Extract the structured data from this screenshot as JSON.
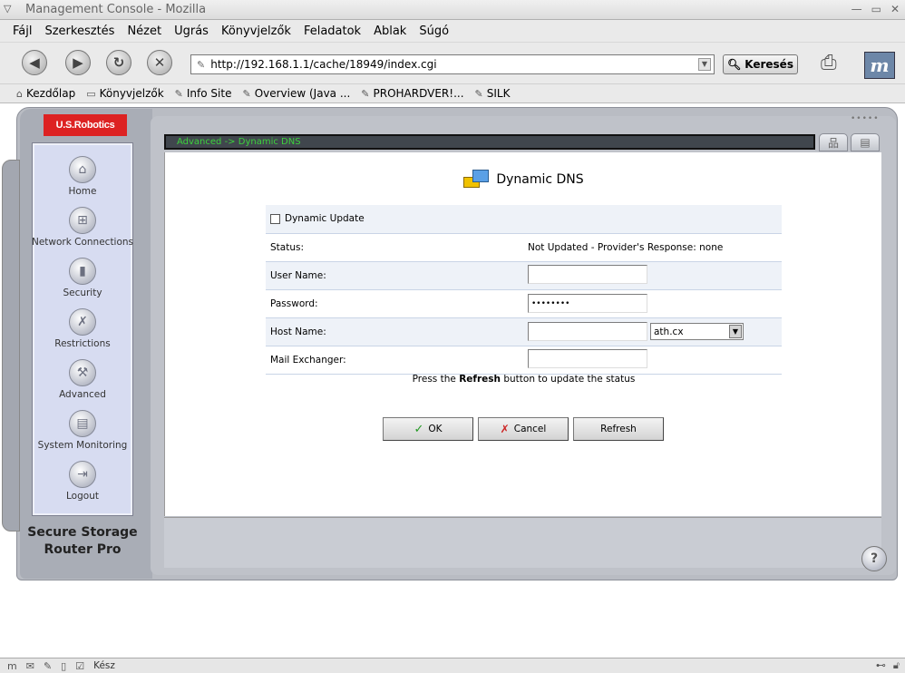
{
  "window": {
    "title": "Management Console - Mozilla"
  },
  "menu": [
    "Fájl",
    "Szerkesztés",
    "Nézet",
    "Ugrás",
    "Könyvjelzők",
    "Feladatok",
    "Ablak",
    "Súgó"
  ],
  "nav": {
    "url": "http://192.168.1.1/cache/18949/index.cgi",
    "search_label": "Keresés"
  },
  "bookmarks": [
    "Kezdőlap",
    "Könyvjelzők",
    "Info Site",
    "Overview (Java ...",
    "PROHARDVER!...",
    "SILK"
  ],
  "router": {
    "logo": "U.S.Robotics",
    "product_line1": "Secure Storage",
    "product_line2": "Router Pro",
    "breadcrumb": "Advanced -> Dynamic DNS",
    "sidebar": [
      {
        "label": "Home",
        "icon": "home-icon"
      },
      {
        "label": "Network Connections",
        "icon": "network-icon"
      },
      {
        "label": "Security",
        "icon": "lock-icon"
      },
      {
        "label": "Restrictions",
        "icon": "restrictions-icon"
      },
      {
        "label": "Advanced",
        "icon": "tools-icon"
      },
      {
        "label": "System Monitoring",
        "icon": "monitor-icon"
      },
      {
        "label": "Logout",
        "icon": "logout-icon"
      }
    ]
  },
  "page": {
    "title": "Dynamic DNS",
    "dynamic_update_label": "Dynamic Update",
    "dynamic_update_checked": false,
    "status_label": "Status:",
    "status_value": "Not Updated  - Provider's Response: none",
    "username_label": "User Name:",
    "username_value": "",
    "password_label": "Password:",
    "password_value": "••••••••",
    "hostname_label": "Host Name:",
    "hostname_value": "",
    "domain_selected": "ath.cx",
    "mail_label": "Mail Exchanger:",
    "mail_value": "",
    "hint_prefix": "Press the ",
    "hint_bold": "Refresh",
    "hint_suffix": " button to update the status",
    "ok_label": "OK",
    "cancel_label": "Cancel",
    "refresh_label": "Refresh"
  },
  "status": {
    "text": "Kész"
  }
}
